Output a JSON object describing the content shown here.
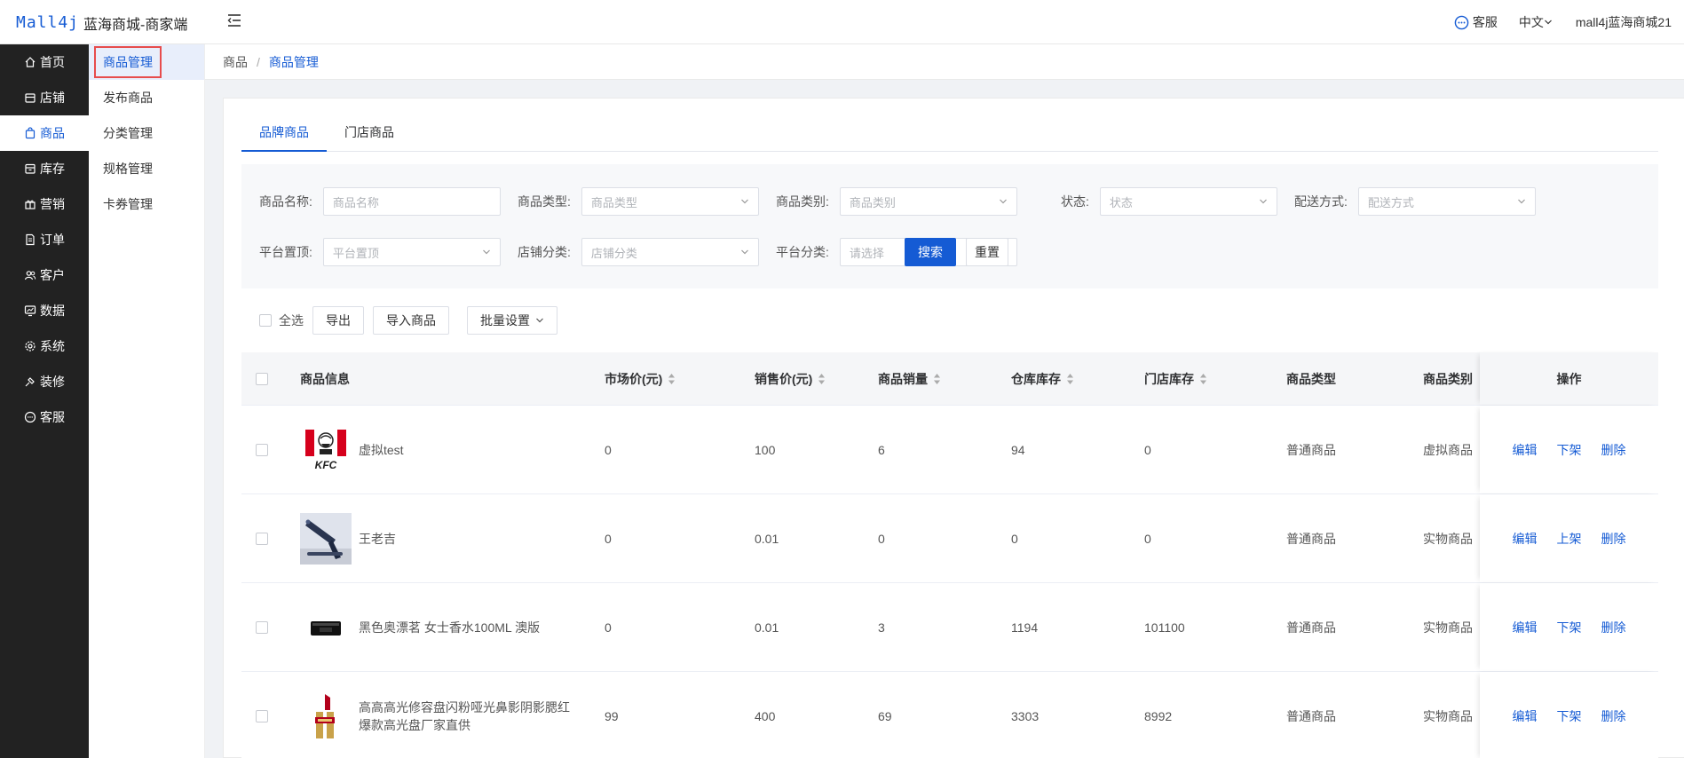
{
  "header": {
    "logo_text": "Mall4j",
    "title": "蓝海商城-商家端",
    "service_label": "客服",
    "lang_label": "中文",
    "user_label": "mall4j蓝海商城21"
  },
  "sidebar_main": [
    {
      "label": "首页",
      "icon": "home-icon"
    },
    {
      "label": "店铺",
      "icon": "shop-icon"
    },
    {
      "label": "商品",
      "icon": "product-bag-icon",
      "active": true
    },
    {
      "label": "库存",
      "icon": "inventory-icon"
    },
    {
      "label": "营销",
      "icon": "gift-icon"
    },
    {
      "label": "订单",
      "icon": "order-doc-icon"
    },
    {
      "label": "客户",
      "icon": "customer-icon"
    },
    {
      "label": "数据",
      "icon": "data-chart-icon"
    },
    {
      "label": "系统",
      "icon": "gear-icon"
    },
    {
      "label": "装修",
      "icon": "decorate-icon"
    },
    {
      "label": "客服",
      "icon": "chat-icon"
    }
  ],
  "sidebar_sub": [
    {
      "label": "商品管理",
      "active": true
    },
    {
      "label": "发布商品"
    },
    {
      "label": "分类管理"
    },
    {
      "label": "规格管理"
    },
    {
      "label": "卡券管理"
    }
  ],
  "breadcrumb": {
    "root": "商品",
    "sep": "/",
    "current": "商品管理"
  },
  "tabs": [
    "品牌商品",
    "门店商品"
  ],
  "filters": {
    "name_label": "商品名称:",
    "name_placeholder": "商品名称",
    "type_label": "商品类型:",
    "type_placeholder": "商品类型",
    "category_label": "商品类别:",
    "category_placeholder": "商品类别",
    "status_label": "状态:",
    "status_placeholder": "状态",
    "delivery_label": "配送方式:",
    "delivery_placeholder": "配送方式",
    "top_label": "平台置顶:",
    "top_placeholder": "平台置顶",
    "shopcat_label": "店铺分类:",
    "shopcat_placeholder": "店铺分类",
    "platcat_label": "平台分类:",
    "platcat_placeholder": "请选择",
    "search_button": "搜索",
    "reset_button": "重置"
  },
  "toolbar": {
    "select_all": "全选",
    "export_button": "导出",
    "import_button": "导入商品",
    "batch_button": "批量设置"
  },
  "table": {
    "headers": {
      "info": "商品信息",
      "market_price": "市场价(元)",
      "sale_price": "销售价(元)",
      "sales": "商品销量",
      "warehouse_stock": "仓库库存",
      "store_stock": "门店库存",
      "type": "商品类型",
      "category": "商品类别",
      "ops": "操作"
    },
    "rows": [
      {
        "name": "虚拟test",
        "market_price": "0",
        "sale_price": "100",
        "sales": "6",
        "warehouse_stock": "94",
        "store_stock": "0",
        "type": "普通商品",
        "category": "虚拟商品",
        "op_edit": "编辑",
        "op_shelf": "下架",
        "op_delete": "删除",
        "thumb": "kfc-logo"
      },
      {
        "name": "王老吉",
        "market_price": "0",
        "sale_price": "0.01",
        "sales": "0",
        "warehouse_stock": "0",
        "store_stock": "0",
        "type": "普通商品",
        "category": "实物商品",
        "op_edit": "编辑",
        "op_shelf": "上架",
        "op_delete": "删除",
        "thumb": "gadget-photo"
      },
      {
        "name": "黑色奥漂茗 女士香水100ML 澳版",
        "market_price": "0",
        "sale_price": "0.01",
        "sales": "3",
        "warehouse_stock": "1194",
        "store_stock": "101100",
        "type": "普通商品",
        "category": "实物商品",
        "op_edit": "编辑",
        "op_shelf": "下架",
        "op_delete": "删除",
        "thumb": "perfume-photo"
      },
      {
        "name": "高高高光修容盘闪粉哑光鼻影阴影腮红爆款高光盘厂家直供",
        "market_price": "99",
        "sale_price": "400",
        "sales": "69",
        "warehouse_stock": "3303",
        "store_stock": "8992",
        "type": "普通商品",
        "category": "实物商品",
        "op_edit": "编辑",
        "op_shelf": "下架",
        "op_delete": "删除",
        "thumb": "lipstick-photo"
      }
    ]
  },
  "colors": {
    "accent": "#155bd4",
    "sidebar_bg": "#222222",
    "highlight_border": "#e74c4c"
  }
}
